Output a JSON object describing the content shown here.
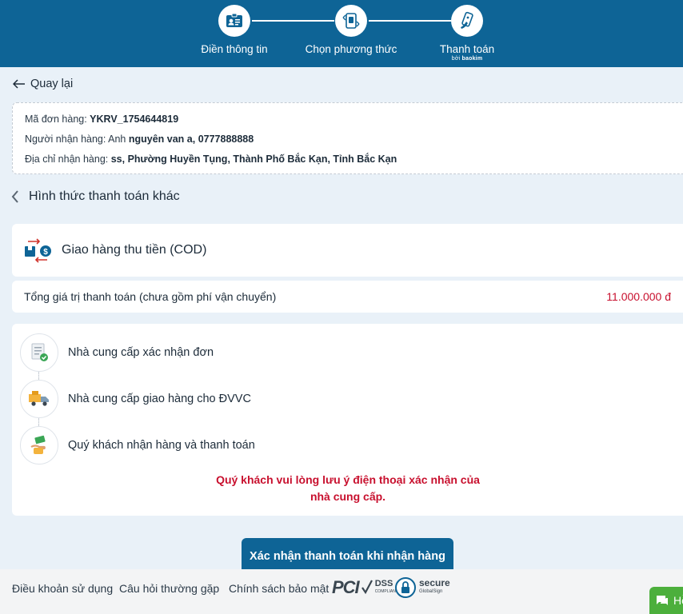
{
  "header": {
    "steps": [
      {
        "label": "Điền thông tin",
        "icon": "contact-card-icon"
      },
      {
        "label": "Chọn phương thức",
        "icon": "payment-method-icon"
      },
      {
        "label": "Thanh toán",
        "icon": "phone-pay-icon",
        "sub_prefix": "bởi",
        "sub_brand": "baokim"
      }
    ]
  },
  "back": {
    "label": "Quay lại"
  },
  "order": {
    "code_label": "Mã đơn hàng: ",
    "code_value": "YKRV_1754644819",
    "recipient_label": "Người nhận hàng: Anh ",
    "recipient_value": "nguyên van a, 0777888888",
    "address_label": "Địa chỉ nhận hàng: ",
    "address_value": "ss, Phường Huyền Tụng, Thành Phố Bắc Kạn, Tỉnh Bắc Kạn"
  },
  "other_methods": {
    "label": "Hình thức thanh toán khác"
  },
  "cod": {
    "label": "Giao hàng thu tiền (COD)"
  },
  "total": {
    "label": "Tổng giá trị thanh toán (chưa gồm phí vận chuyển)",
    "amount": "11.000.000 đ"
  },
  "process": {
    "items": [
      {
        "label": "Nhà cung cấp xác nhận đơn"
      },
      {
        "label": "Nhà cung cấp giao hàng cho ĐVVC"
      },
      {
        "label": "Quý khách nhận hàng và thanh toán"
      }
    ],
    "note": "Quý khách vui lòng lưu ý điện thoại xác nhận của nhà cung cấp."
  },
  "confirm_button": "Xác nhận thanh toán khi nhận hàng",
  "footer": {
    "links": [
      "Điều khoản sử dụng",
      "Câu hỏi thường gặp",
      "Chính sách bảo mật"
    ],
    "pci": {
      "logo": "PCI",
      "dss": "DSS",
      "compliant": "COMPLIANT"
    },
    "secure": {
      "title": "secure",
      "sub": "GlobalSign"
    }
  },
  "chat": {
    "label": "Hỗ"
  },
  "colors": {
    "primary": "#0e6496",
    "accent_red": "#c8102e",
    "chat_green": "#4caf3c"
  }
}
